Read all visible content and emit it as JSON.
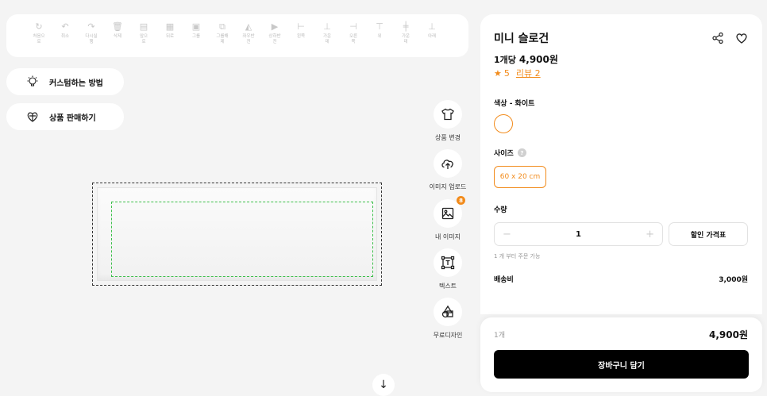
{
  "toolbar": [
    {
      "icon": "reset-icon",
      "glyph": "↻",
      "label": "처음으\n로"
    },
    {
      "icon": "undo-icon",
      "glyph": "↶",
      "label": "취소"
    },
    {
      "icon": "redo-icon",
      "glyph": "↷",
      "label": "다시실\n행"
    },
    {
      "icon": "delete-icon",
      "glyph": "🗑",
      "label": "삭제"
    },
    {
      "icon": "bring-forward-icon",
      "glyph": "▤",
      "label": "앞으\n로"
    },
    {
      "icon": "send-backward-icon",
      "glyph": "▦",
      "label": "뒤로"
    },
    {
      "icon": "group-icon",
      "glyph": "▣",
      "label": "그룹"
    },
    {
      "icon": "ungroup-icon",
      "glyph": "⧉",
      "label": "그룹해\n제"
    },
    {
      "icon": "flip-horizontal-icon",
      "glyph": "◭",
      "label": "좌우반\n전"
    },
    {
      "icon": "flip-vertical-icon",
      "glyph": "▶",
      "label": "상하반\n전"
    },
    {
      "icon": "align-left-icon",
      "glyph": "⊢",
      "label": "왼쪽"
    },
    {
      "icon": "align-center-icon",
      "glyph": "⊥",
      "label": "가운\n데"
    },
    {
      "icon": "align-right-icon",
      "glyph": "⊣",
      "label": "오른\n쪽"
    },
    {
      "icon": "align-top-icon",
      "glyph": "⊤",
      "label": "위"
    },
    {
      "icon": "align-middle-icon",
      "glyph": "╪",
      "label": "가운\n데"
    },
    {
      "icon": "align-bottom-icon",
      "glyph": "⊥",
      "label": "아래"
    }
  ],
  "left_buttons": {
    "how_to": "커스텀하는 방법",
    "sell": "상품 판매하기"
  },
  "side_tools": {
    "change_product": "상품 변경",
    "upload": "이미지 업로드",
    "my_images": "내 이미지",
    "my_images_badge": "8",
    "text": "텍스트",
    "free_design": "무료디자인"
  },
  "product": {
    "title": "미니 슬로건",
    "unit_label": "1개당",
    "unit_price": "4,900원",
    "rating_star": "★",
    "rating": "5",
    "reviews": "리뷰 2",
    "color_label": "색상 - 화이트",
    "swatch_color": "#ffffff",
    "size_label": "사이즈",
    "size_help": "?",
    "size_option": "60 x 20 cm",
    "qty_label": "수량",
    "qty_minus": "−",
    "qty_value": "1",
    "qty_plus": "+",
    "discount_button": "할인 가격표",
    "min_order": "1 개 부터 주문 가능",
    "shipping_label": "배송비",
    "shipping_value": "3,000원"
  },
  "footer": {
    "count": "1개",
    "total": "4,900원",
    "cart_button": "장바구니 담기"
  },
  "colors": {
    "accent": "#f28b1b",
    "guide": "#3cbf4a"
  }
}
